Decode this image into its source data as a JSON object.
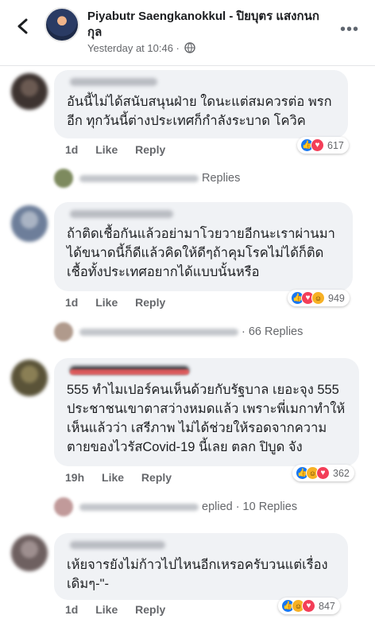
{
  "header": {
    "name": "Piyabutr Saengkanokkul - ปิยบุตร แสงกนกกุล",
    "time": "Yesterday at 10:46 ·",
    "more": "•••"
  },
  "comments": [
    {
      "text": "อันนี้ไม่ได้สนับสนุนฝ่าย ใดนะแต่สมควรต่อ พรกอีก ทุกวันนี้ต่างประเทศก็กำลังระบาด โควิค",
      "time": "1d",
      "like": "Like",
      "reply": "Reply",
      "reactions": "617",
      "replies": "Replies"
    },
    {
      "text": "ถ้าติดเชื้อกันแล้วอย่ามาโวยวายอีกนะเราผ่านมาได้ขนาดนี้ก็ดีแล้วคิดให้ดีๆถ้าคุมโรคไม่ได้ก็ติดเชื้อทั้งประเทศอยากได้แบบนั้นหรือ",
      "time": "1d",
      "like": "Like",
      "reply": "Reply",
      "reactions": "949",
      "replies": "· 66 Replies"
    },
    {
      "text": "555 ทำไมเปอร์คนเห็นด้วยกับรัฐบาล เยอะจุง 555 ประชาชนเขาตาสว่างหมดแล้ว เพราะพี่เมกาทำให้เห็นแล้วว่า เสรีภาพ ไม่ได้ช่วยให้รอดจากความตายของไวรัสCovid-19 นี้เลย ตลก ปิบูด จัง",
      "time": "19h",
      "like": "Like",
      "reply": "Reply",
      "reactions": "362",
      "replies_prefix": "eplied",
      "replies": "· 10 Replies"
    },
    {
      "text": "เห้ยจารยังไม่ก้าวไปไหนอีกเหรอครับวนแต่เรื่องเดิมๆ-\"-",
      "time": "1d",
      "like": "Like",
      "reply": "Reply",
      "reactions": "847"
    }
  ]
}
